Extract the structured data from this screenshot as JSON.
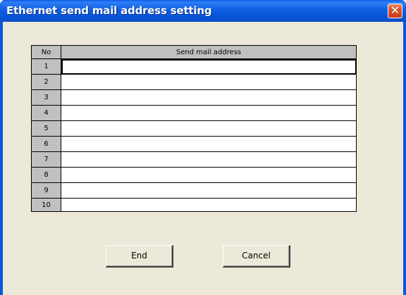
{
  "window": {
    "title": "Ethernet send mail address setting",
    "close_glyph": "✕"
  },
  "table": {
    "col_no": "No",
    "col_address": "Send mail address",
    "rows": [
      {
        "no": "1",
        "address": ""
      },
      {
        "no": "2",
        "address": ""
      },
      {
        "no": "3",
        "address": ""
      },
      {
        "no": "4",
        "address": ""
      },
      {
        "no": "5",
        "address": ""
      },
      {
        "no": "6",
        "address": ""
      },
      {
        "no": "7",
        "address": ""
      },
      {
        "no": "8",
        "address": ""
      },
      {
        "no": "9",
        "address": ""
      },
      {
        "no": "10",
        "address": ""
      }
    ]
  },
  "buttons": {
    "end_label": "End",
    "cancel_label": "Cancel"
  }
}
